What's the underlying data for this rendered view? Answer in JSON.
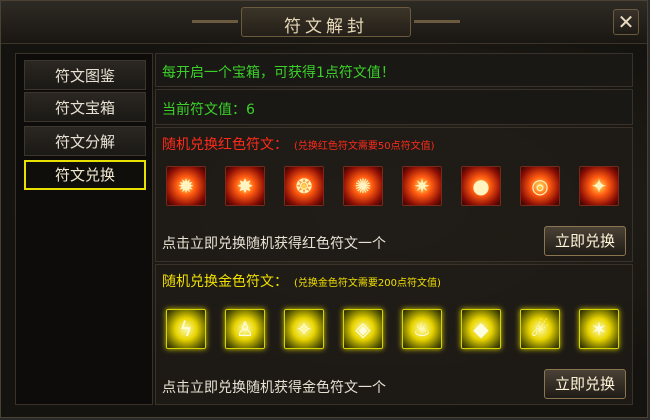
{
  "window": {
    "title": "符文解封",
    "close_glyph": "✕"
  },
  "sidebar": {
    "items": [
      {
        "label": "符文图鉴",
        "active": false
      },
      {
        "label": "符文宝箱",
        "active": false
      },
      {
        "label": "符文分解",
        "active": false
      },
      {
        "label": "符文兑换",
        "active": true
      }
    ]
  },
  "info": {
    "hint": "每开启一个宝箱，可获得1点符文值！",
    "current_value": "当前符文值：6"
  },
  "red_section": {
    "heading": "随机兑换红色符文：",
    "note": "(兑换红色符文需要50点符文值)",
    "icons": [
      "flame-icon",
      "fire-burst-icon",
      "fire-pillar-icon",
      "fire-dragon-icon",
      "fire-demon-icon",
      "fire-orb-icon",
      "fire-swirl-icon",
      "fire-bird-icon"
    ],
    "description": "点击立即兑换随机获得红色符文一个",
    "button": "立即兑换",
    "color": "#ff2b1a"
  },
  "gold_section": {
    "heading": "随机兑换金色符文：",
    "note": "(兑换金色符文需要200点符文值)",
    "icons": [
      "lightning-strike-icon",
      "golden-figure-icon",
      "golden-spark-icon",
      "golden-shield-icon",
      "golden-flame-icon",
      "golden-gem-icon",
      "golden-comet-icon",
      "golden-burst-icon"
    ],
    "description": "点击立即兑换随机获得金色符文一个",
    "button": "立即兑换",
    "color": "#f0e000"
  }
}
